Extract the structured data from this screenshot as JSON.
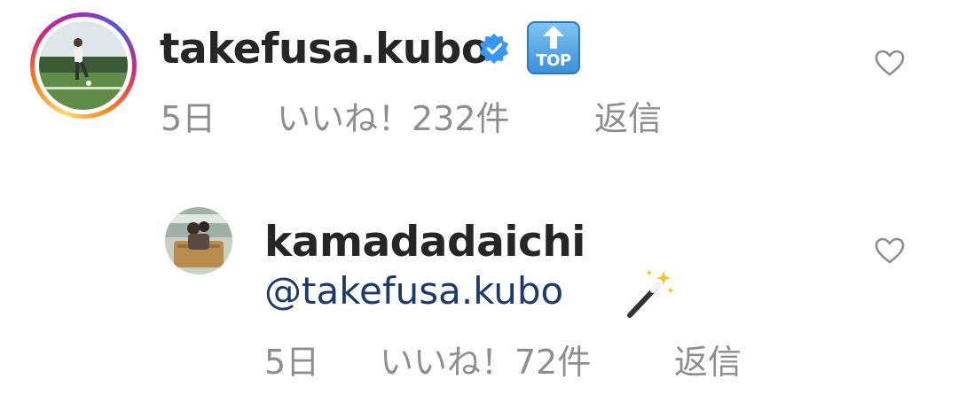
{
  "comments": [
    {
      "username": "takefusa.kubo",
      "verified": true,
      "has_story_ring": true,
      "emoji": "top-arrow-emoji",
      "emoji_label": "TOP",
      "time": "5日",
      "likes": "いいね！232件",
      "reply_label": "返信"
    }
  ],
  "replies": [
    {
      "username": "kamadadaichi",
      "mention": "@takefusa.kubo",
      "emoji": "magic-wand-emoji",
      "time": "5日",
      "likes": "いいね！72件",
      "reply_label": "返信"
    }
  ],
  "colors": {
    "username": "#262626",
    "meta": "#8e8e8e",
    "mention": "#1d3a6b",
    "verified": "#3897f0"
  }
}
